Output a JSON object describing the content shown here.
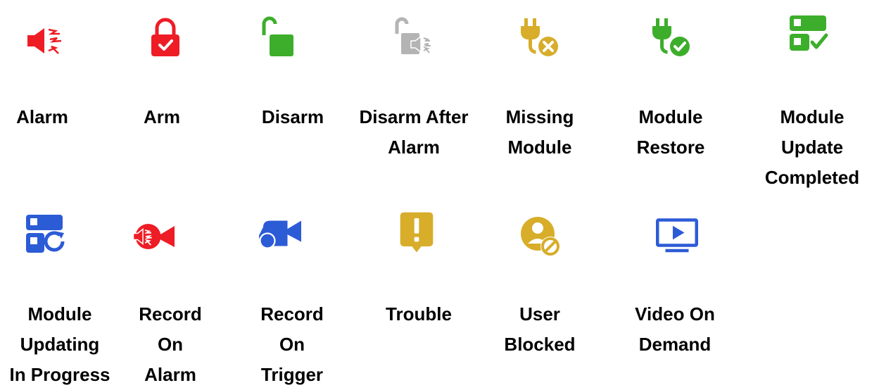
{
  "colors": {
    "red": "#ee1c25",
    "green": "#3dae2b",
    "gray": "#b4b4b4",
    "yellow": "#d7ad2a",
    "blue": "#2c5bd6"
  },
  "row1": [
    {
      "label": "Alarm",
      "icon": "alarm-siren-icon"
    },
    {
      "label": "Arm",
      "icon": "lock-check-icon"
    },
    {
      "label": "Disarm",
      "icon": "unlock-icon"
    },
    {
      "label": "Disarm After\nAlarm",
      "icon": "unlock-siren-icon"
    },
    {
      "label": "Missing\nModule",
      "icon": "plug-x-icon"
    },
    {
      "label": "Module\nRestore",
      "icon": "plug-check-icon"
    },
    {
      "label": "Module\nUpdate\nCompleted",
      "icon": "module-check-icon"
    }
  ],
  "row2": [
    {
      "label": "Module\nUpdating\nIn Progress",
      "icon": "module-refresh-icon"
    },
    {
      "label": "Record\nOn\nAlarm",
      "icon": "camera-siren-icon"
    },
    {
      "label": "Record\nOn\nTrigger",
      "icon": "camera-trigger-icon"
    },
    {
      "label": "Trouble",
      "icon": "trouble-exclamation-icon"
    },
    {
      "label": "User\nBlocked",
      "icon": "user-blocked-icon"
    },
    {
      "label": "Video On\nDemand",
      "icon": "video-play-icon"
    }
  ]
}
